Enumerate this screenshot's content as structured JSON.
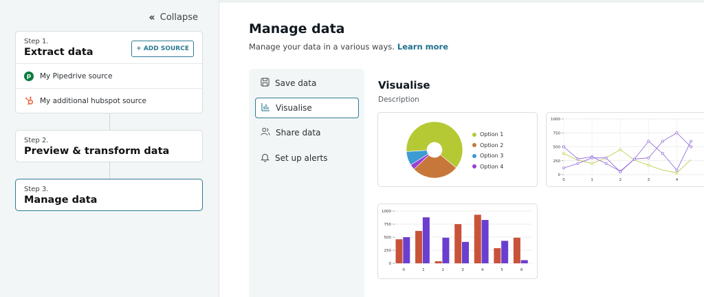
{
  "sidebar": {
    "collapse_label": "Collapse",
    "steps": [
      {
        "step": "Step 1.",
        "title": "Extract data",
        "add_source_label": "+ ADD SOURCE",
        "sources": [
          {
            "label": "My Pipedrive source",
            "icon": "pipedrive-icon"
          },
          {
            "label": "My additional hubspot source",
            "icon": "hubspot-icon"
          }
        ]
      },
      {
        "step": "Step 2.",
        "title": "Preview & transform data"
      },
      {
        "step": "Step 3.",
        "title": "Manage data"
      }
    ]
  },
  "main": {
    "title": "Manage data",
    "subtitle": "Manage your data in a various ways.",
    "learn_more": "Learn more",
    "menu": [
      {
        "label": "Save data",
        "icon": "floppy-disk-icon"
      },
      {
        "label": "Visualise",
        "icon": "bar-chart-icon",
        "active": true
      },
      {
        "label": "Share data",
        "icon": "users-icon"
      },
      {
        "label": "Set up alerts",
        "icon": "bell-icon"
      }
    ],
    "visualise_title": "Visualise",
    "visualise_desc": "Description"
  },
  "colors": {
    "accent": "#2b7a92",
    "option1": "#b5c935",
    "option2": "#c8773a",
    "option3": "#3d9bd4",
    "option4": "#9b3fd6",
    "bar_a": "#c9533a",
    "bar_b": "#6a3fcf"
  },
  "chart_data": [
    {
      "type": "pie",
      "donut": true,
      "categories": [
        "Option 1",
        "Option 2",
        "Option 3",
        "Option 4"
      ],
      "values": [
        62,
        27,
        8,
        3
      ],
      "legend": "right"
    },
    {
      "type": "line",
      "x": [
        0,
        0.5,
        1,
        1.5,
        2,
        2.5,
        3,
        3.5,
        4,
        4.5
      ],
      "ylim": [
        0,
        1000
      ],
      "yticks": [
        0,
        250,
        500,
        750,
        1000
      ],
      "xticks": [
        0,
        1,
        2,
        3,
        4
      ],
      "series": [
        {
          "values": [
            380,
            260,
            200,
            300,
            450,
            260,
            170,
            80,
            30,
            270
          ]
        },
        {
          "values": [
            500,
            280,
            320,
            200,
            60,
            280,
            300,
            600,
            750,
            500
          ]
        },
        {
          "values": [
            120,
            200,
            300,
            300,
            50,
            280,
            600,
            380,
            80,
            600
          ]
        }
      ]
    },
    {
      "type": "bar",
      "categories": [
        "0",
        "1",
        "2",
        "3",
        "4",
        "5",
        "6"
      ],
      "ylim": [
        0,
        1000
      ],
      "yticks": [
        0,
        250,
        500,
        750,
        1000
      ],
      "series": [
        {
          "values": [
            460,
            620,
            40,
            750,
            930,
            290,
            490
          ]
        },
        {
          "values": [
            500,
            880,
            490,
            410,
            830,
            430,
            60
          ]
        }
      ]
    }
  ]
}
